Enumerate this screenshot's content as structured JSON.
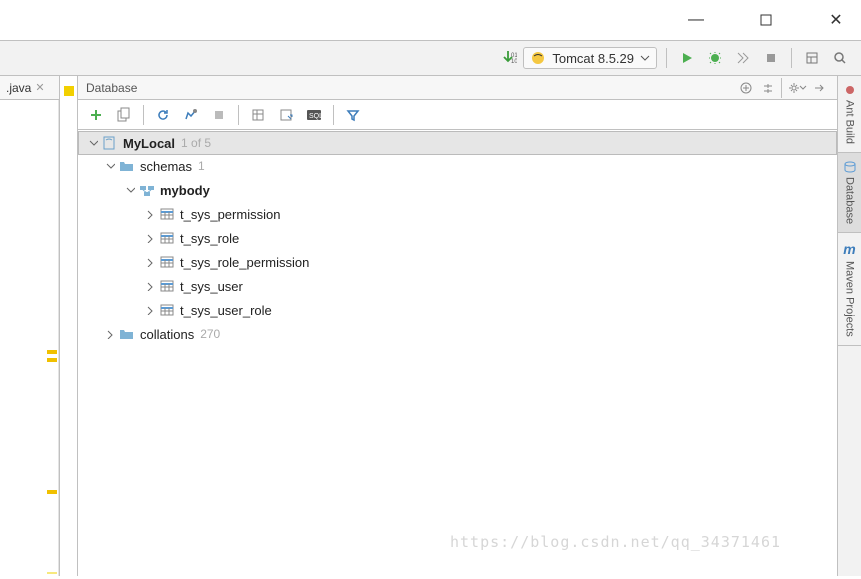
{
  "window": {
    "minimize": "—",
    "maximize": "▢",
    "close": "✕"
  },
  "runbar": {
    "arrow_icon": "download-arrow",
    "numbers": "01\n10",
    "tomcat_name": "Tomcat 8.5.29"
  },
  "editor_tab": {
    "label": ".java"
  },
  "db_panel": {
    "title": "Database",
    "datasource": {
      "name": "MyLocal",
      "badge": "1 of 5"
    },
    "schemas_label": "schemas",
    "schemas_count": "1",
    "schema_name": "mybody",
    "tables": [
      "t_sys_permission",
      "t_sys_role",
      "t_sys_role_permission",
      "t_sys_user",
      "t_sys_user_role"
    ],
    "collations_label": "collations",
    "collations_count": "270"
  },
  "sidetabs": {
    "ant": "Ant Build",
    "database": "Database",
    "maven": "Maven Projects"
  },
  "watermark": "https://blog.csdn.net/qq_34371461"
}
